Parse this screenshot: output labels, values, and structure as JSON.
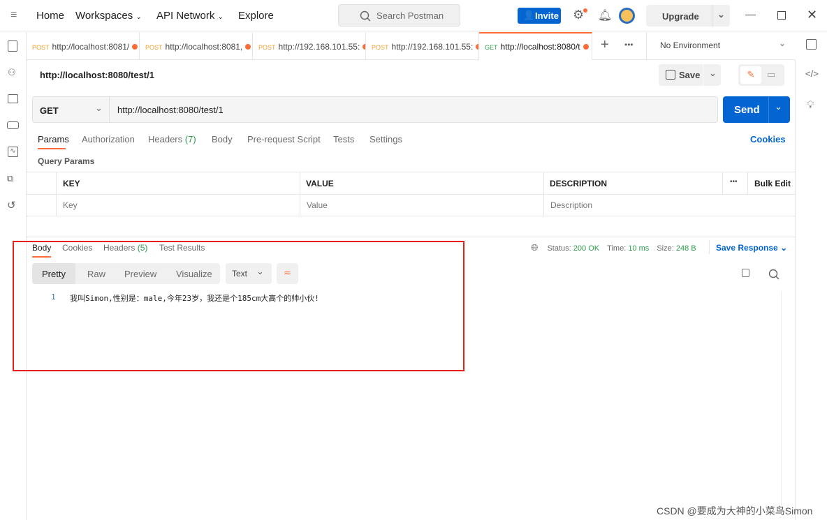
{
  "topbar": {
    "nav": [
      "Home",
      "Workspaces",
      "API Network",
      "Explore"
    ],
    "search_placeholder": "Search Postman",
    "invite": "Invite",
    "upgrade": "Upgrade"
  },
  "tabs": [
    {
      "method": "POST",
      "url": "http://localhost:8081/",
      "method_color": "#f0a12e"
    },
    {
      "method": "POST",
      "url": "http://localhost:8081,",
      "method_color": "#f0a12e"
    },
    {
      "method": "POST",
      "url": "http://192.168.101.55:",
      "method_color": "#f0a12e"
    },
    {
      "method": "POST",
      "url": "http://192.168.101.55:",
      "method_color": "#f0a12e"
    },
    {
      "method": "GET",
      "url": "http://localhost:8080/t",
      "method_color": "#2a9d4a",
      "active": true
    }
  ],
  "environment": "No Environment",
  "request": {
    "title": "http://localhost:8080/test/1",
    "save": "Save",
    "method": "GET",
    "url": "http://localhost:8080/test/1",
    "send": "Send"
  },
  "req_tabs": {
    "params": "Params",
    "authorization": "Authorization",
    "headers": "Headers",
    "headers_count": "(7)",
    "body": "Body",
    "prerequest": "Pre-request Script",
    "tests": "Tests",
    "settings": "Settings",
    "cookies": "Cookies"
  },
  "query": {
    "title": "Query Params",
    "headers": [
      "KEY",
      "VALUE",
      "DESCRIPTION"
    ],
    "bulk_edit": "Bulk Edit",
    "placeholders": [
      "Key",
      "Value",
      "Description"
    ]
  },
  "response": {
    "tabs": [
      "Body",
      "Cookies",
      "Headers",
      "Test Results"
    ],
    "headers_count": "(5)",
    "status_label": "Status:",
    "status": "200 OK",
    "time_label": "Time:",
    "time": "10 ms",
    "size_label": "Size:",
    "size": "248 B",
    "save_response": "Save Response",
    "views": [
      "Pretty",
      "Raw",
      "Preview",
      "Visualize"
    ],
    "format": "Text",
    "lines": [
      {
        "n": "1",
        "text": "我叫Simon,性别是：male,今年23岁，我还是个185cm大高个的帅小伙!"
      }
    ]
  },
  "watermark": "CSDN @要成为大神的小菜鸟Simon",
  "colors": {
    "accent": "#ff6c37",
    "primary": "#0265d2",
    "success": "#2a9d4a",
    "highlight": "#e8201c"
  }
}
